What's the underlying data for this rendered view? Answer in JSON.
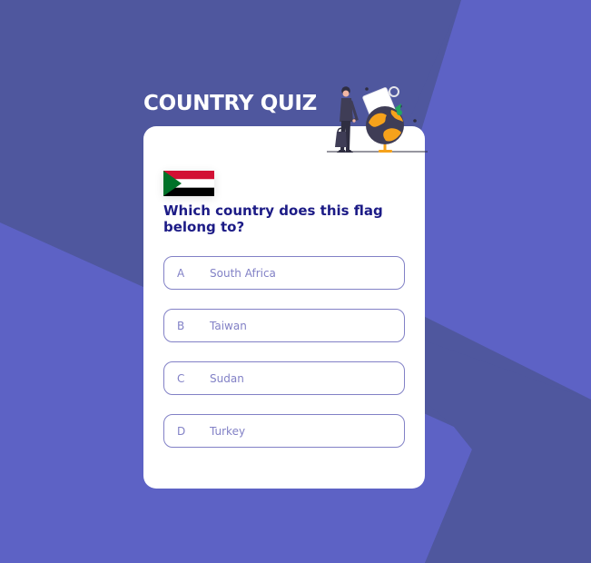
{
  "app": {
    "title": "COUNTRY QUIZ"
  },
  "quiz": {
    "question": "Which country does this flag belong to?",
    "flag_icon": "sudan-flag-icon",
    "illustration_icon": "traveler-globe-illustration",
    "answers": [
      {
        "letter": "A",
        "text": "South Africa"
      },
      {
        "letter": "B",
        "text": "Taiwan"
      },
      {
        "letter": "C",
        "text": "Sudan"
      },
      {
        "letter": "D",
        "text": "Turkey"
      }
    ]
  },
  "theme": {
    "background_dark": "#4F579E",
    "background_light": "#5E62C5",
    "card": "#FFFFFF",
    "accent": "#8281C6",
    "question_text": "#1C1B86",
    "flag_red": "#D21034",
    "flag_white": "#FFFFFF",
    "flag_black": "#000000",
    "flag_green": "#007229"
  }
}
